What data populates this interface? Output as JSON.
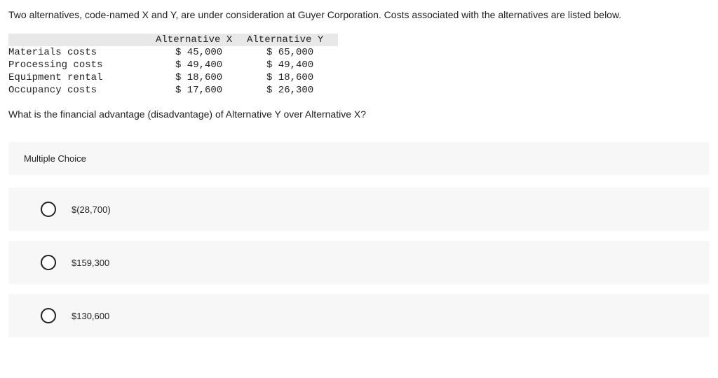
{
  "intro": "Two alternatives, code-named X and Y, are under consideration at Guyer Corporation. Costs associated with the alternatives are listed below.",
  "table": {
    "headers": {
      "label": "",
      "altx": "Alternative X",
      "alty": "Alternative Y"
    },
    "rows": [
      {
        "label": "Materials costs",
        "x": "$ 45,000",
        "y": "$ 65,000"
      },
      {
        "label": "Processing costs",
        "x": "$ 49,400",
        "y": "$ 49,400"
      },
      {
        "label": "Equipment rental",
        "x": "$ 18,600",
        "y": "$ 18,600"
      },
      {
        "label": "Occupancy costs",
        "x": "$ 17,600",
        "y": "$ 26,300"
      }
    ]
  },
  "question": "What is the financial advantage (disadvantage) of Alternative Y over Alternative X?",
  "mc_label": "Multiple Choice",
  "options": [
    {
      "text": "$(28,700)"
    },
    {
      "text": "$159,300"
    },
    {
      "text": "$130,600"
    }
  ]
}
